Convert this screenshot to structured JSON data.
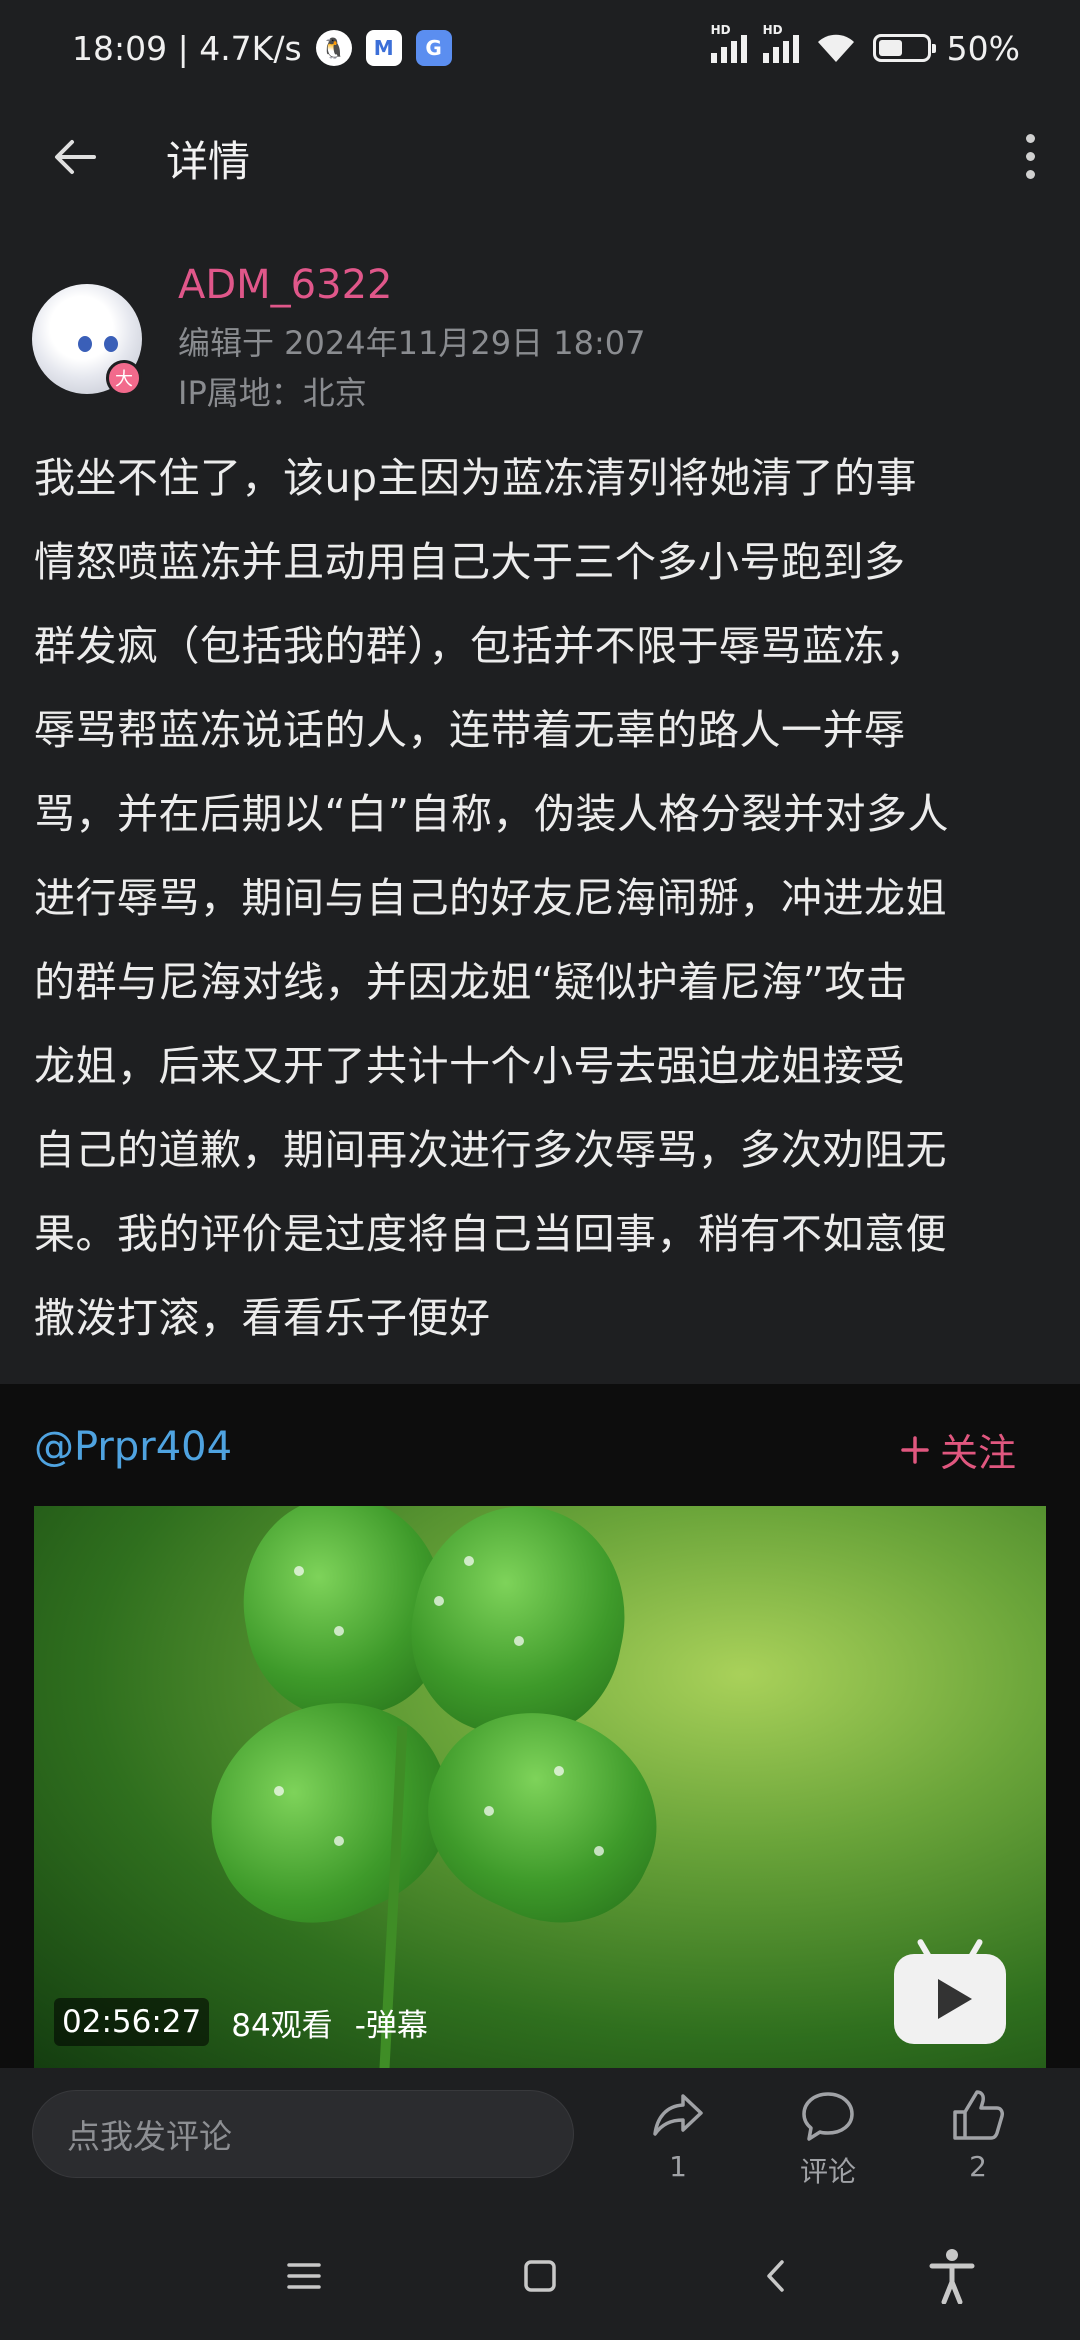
{
  "status_bar": {
    "time_net": "18:09 | 4.7K/s",
    "qq_icon": "qq-icon",
    "mail_icon": "mail-icon",
    "translate_icon": "translate-icon",
    "hd1": "HD",
    "hd2": "HD",
    "battery_percent": "50%",
    "battery_level": 0.5
  },
  "header": {
    "title": "详情",
    "back_icon": "arrow-left-icon",
    "more_icon": "more-vertical-icon"
  },
  "author": {
    "name": "ADM_6322",
    "edited": "编辑于 2024年11月29日 18:07",
    "ip": "IP属地：北京",
    "badge": "大"
  },
  "post": {
    "lines": [
      "我坐不住了，该up主因为蓝冻清列将她清了的事",
      "情怒喷蓝冻并且动用自己大于三个多小号跑到多",
      "群发疯（包括我的群），包括并不限于辱骂蓝冻，",
      "辱骂帮蓝冻说话的人，连带着无辜的路人一并辱",
      "骂，并在后期以“白”自称，伪装人格分裂并对多人",
      "进行辱骂，期间与自己的好友尼海闹掰，冲进龙姐",
      "的群与尼海对线，并因龙姐“疑似护着尼海”攻击",
      "龙姐，后来又开了共计十个小号去强迫龙姐接受",
      "自己的道歉，期间再次进行多次辱骂，多次劝阻无",
      "果。我的评价是过度将自己当回事，稍有不如意便",
      "撒泼打滚，看看乐子便好"
    ]
  },
  "card": {
    "mention": "@Prpr404",
    "follow_label": "关注",
    "follow_icon": "plus-icon"
  },
  "video": {
    "duration": "02:56:27",
    "views": "84观看",
    "danmaku": "-弹幕",
    "play_icon": "tv-play-icon"
  },
  "bottom_bar": {
    "comment_placeholder": "点我发评论",
    "share_count": "1",
    "comment_label": "评论",
    "like_count": "2"
  },
  "nav": {
    "menu_icon": "menu-icon",
    "home_icon": "square-icon",
    "back_icon": "chevron-left-icon",
    "accessibility_icon": "accessibility-icon"
  }
}
